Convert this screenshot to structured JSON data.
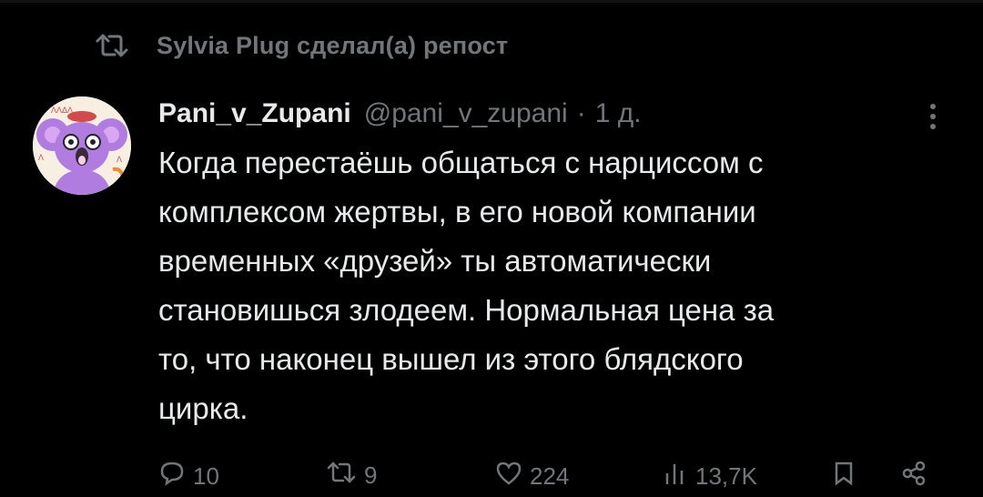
{
  "repost": {
    "text": "Sylvia Plug сделал(а) репост",
    "icon": "repost-icon"
  },
  "tweet": {
    "author_name": "Pani_v_Zupani",
    "author_handle": "@pani_v_zupani",
    "separator": "·",
    "time_ago": "1 д.",
    "lines": [
      "Когда перестаёшь общаться с нарциссом с",
      "комплексом жертвы, в его новой компании",
      "временных «друзей» ты автоматически",
      "становишься злодеем. Нормальная цена за",
      "то, что наконец вышел из этого блядского",
      "цирка."
    ]
  },
  "actions": {
    "replies": "10",
    "reposts": "9",
    "likes": "224",
    "views": "13,7K"
  },
  "colors": {
    "background": "#000000",
    "text": "#e7e9ea",
    "muted": "#71767b",
    "avatar_purple": "#b07ce0"
  }
}
